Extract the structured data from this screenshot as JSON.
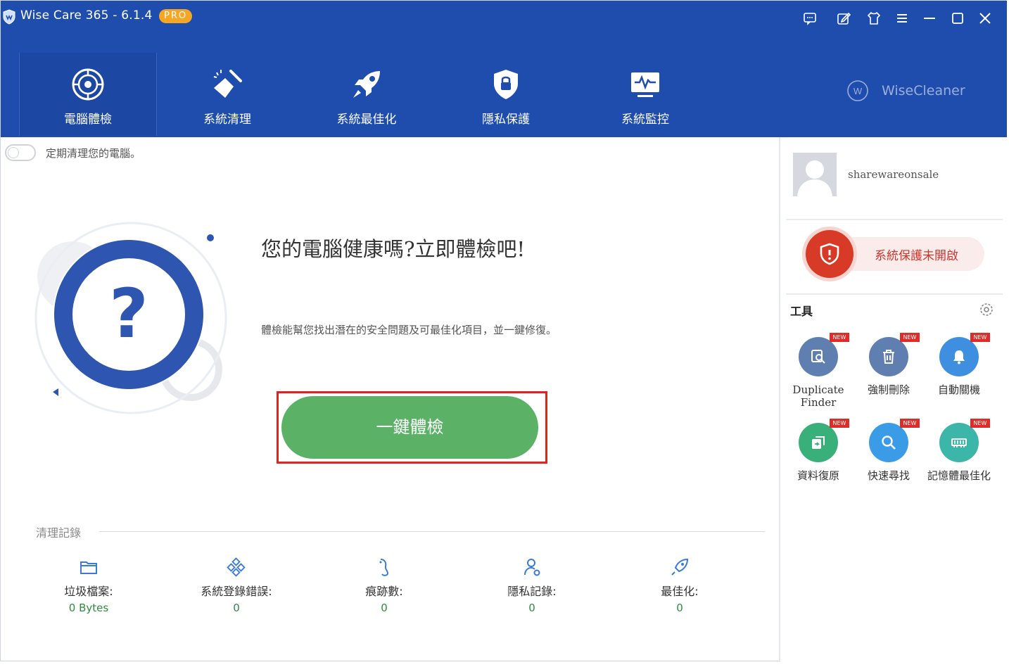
{
  "app": {
    "title": "Wise Care 365 - 6.1.4",
    "badge": "PRO",
    "brand": "WiseCleaner",
    "colors": {
      "header": "#1f4dae",
      "accent_green": "#5bb266",
      "alert_red": "#d73a26"
    }
  },
  "window_controls": [
    {
      "name": "feedback-icon"
    },
    {
      "name": "edit-icon"
    },
    {
      "name": "skin-icon"
    },
    {
      "name": "menu-icon"
    },
    {
      "name": "minimize-icon"
    },
    {
      "name": "maximize-icon"
    },
    {
      "name": "close-icon"
    }
  ],
  "nav": {
    "tabs": [
      {
        "label": "電腦體檢",
        "icon": "radar-icon",
        "active": true
      },
      {
        "label": "系統清理",
        "icon": "broom-icon",
        "active": false
      },
      {
        "label": "系統最佳化",
        "icon": "rocket-icon",
        "active": false
      },
      {
        "label": "隱私保護",
        "icon": "shield-lock-icon",
        "active": false
      },
      {
        "label": "系統監控",
        "icon": "monitor-icon",
        "active": false
      }
    ]
  },
  "main": {
    "schedule_toggle_label": "定期清理您的電腦。",
    "headline": "您的電腦健康嗎?立即體檢吧!",
    "subline": "體檢能幫您找出潛在的安全問題及可最佳化項目，並一鍵修復。",
    "check_button": "一鍵體檢",
    "records_title": "清理記錄",
    "records": [
      {
        "label": "垃圾檔案:",
        "value": "0 Bytes",
        "icon": "folder-icon"
      },
      {
        "label": "系統登錄錯誤:",
        "value": "0",
        "icon": "registry-icon"
      },
      {
        "label": "痕跡數:",
        "value": "0",
        "icon": "footprint-icon"
      },
      {
        "label": "隱私記錄:",
        "value": "0",
        "icon": "user-privacy-icon"
      },
      {
        "label": "最佳化:",
        "value": "0",
        "icon": "rocket-icon"
      }
    ]
  },
  "sidebar": {
    "username": "sharewareonsale",
    "protection_status": "系統保護未開啟",
    "tools_title": "工具",
    "new_badge": "NEW",
    "tools": [
      {
        "label": "Duplicate Finder",
        "icon": "duplicate-finder-icon",
        "color": "#5f7fb0",
        "new": true
      },
      {
        "label": "強制刪除",
        "icon": "trash-icon",
        "color": "#5f7fb0",
        "new": true
      },
      {
        "label": "自動關機",
        "icon": "bell-icon",
        "color": "#3f8fe0",
        "new": true
      },
      {
        "label": "資料復原",
        "icon": "data-recovery-icon",
        "color": "#39b07a",
        "new": true
      },
      {
        "label": "快速尋找",
        "icon": "search-icon",
        "color": "#3a9be6",
        "new": true
      },
      {
        "label": "記憶體最佳化",
        "icon": "memory-icon",
        "color": "#3bb6a8",
        "new": true
      }
    ]
  }
}
